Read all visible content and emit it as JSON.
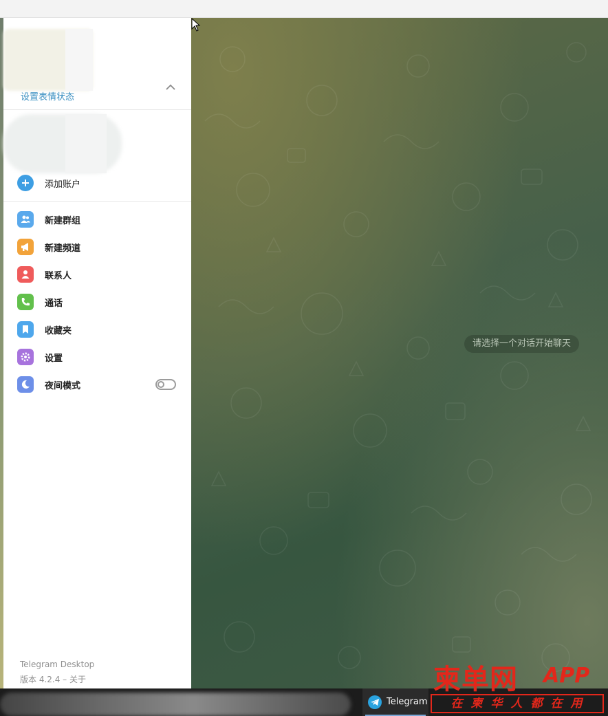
{
  "menu": {
    "set_emoji_status": "设置表情状态",
    "add_account": "添加账户",
    "items": [
      {
        "label": "新建群组",
        "icon": "group-icon",
        "color": "#5aa9ec"
      },
      {
        "label": "新建频道",
        "icon": "megaphone-icon",
        "color": "#f2a33a"
      },
      {
        "label": "联系人",
        "icon": "contact-icon",
        "color": "#ef5b5b"
      },
      {
        "label": "通话",
        "icon": "phone-icon",
        "color": "#62c04c"
      },
      {
        "label": "收藏夹",
        "icon": "bookmark-icon",
        "color": "#4ea7ec"
      },
      {
        "label": "设置",
        "icon": "gear-icon",
        "color": "#a773dd"
      },
      {
        "label": "夜间模式",
        "icon": "moon-icon",
        "color": "#6d8fe8"
      }
    ],
    "night_mode_enabled": false,
    "footer_app": "Telegram Desktop",
    "footer_version": "版本 4.2.4 – 关于"
  },
  "chat": {
    "empty_hint": "请选择一个对话开始聊天"
  },
  "taskbar": {
    "app_label": "Telegram"
  },
  "watermark": {
    "title": "柬单网",
    "app": "APP",
    "slogan": "在柬华人都在用"
  },
  "colors": {
    "accent": "#3a8fc1",
    "chat_bg": "#3f5a45"
  }
}
